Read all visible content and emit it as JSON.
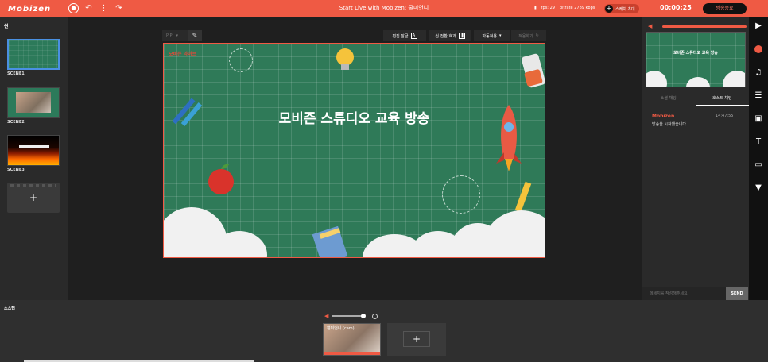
{
  "app": {
    "logo": "Mobizen",
    "window_title": "Start Live with Mobizen: 쿨미언니",
    "fps": "fps: 29",
    "bitrate": "bitrate 2789 kbps",
    "guide_label": "스케치 초대",
    "timer": "00:00:25",
    "end_button": "방송종료"
  },
  "scenes": {
    "title": "씬",
    "items": [
      {
        "label": "SCENE1"
      },
      {
        "label": "SCENE2"
      },
      {
        "label": "SCENE3"
      }
    ],
    "add_label": "+"
  },
  "toolbar": {
    "pip_label": "PIP",
    "edit_label": "편집 잠금",
    "edit_icon": "A",
    "transition_label": "씬 전환 효과",
    "auto_label": "자동적용",
    "apply_label": "적용하기"
  },
  "stage": {
    "title": "모비즌 스튜디오 교육 방송",
    "logo": "모비즌 라이브"
  },
  "right": {
    "preview_title": "모비즌 스튜디오 교육 방송",
    "tabs": [
      {
        "label": "소셜 채팅"
      },
      {
        "label": "호스트 채팅"
      }
    ],
    "chat": {
      "name": "Mobizen",
      "time": "14:47:55",
      "message": "방송을 시작했습니다."
    },
    "input_placeholder": "메세지를 작성해주세요.",
    "send_label": "SEND"
  },
  "bottom": {
    "title": "소스탭",
    "cam_label": "캠미언니 (cam)",
    "add_label": "+"
  }
}
